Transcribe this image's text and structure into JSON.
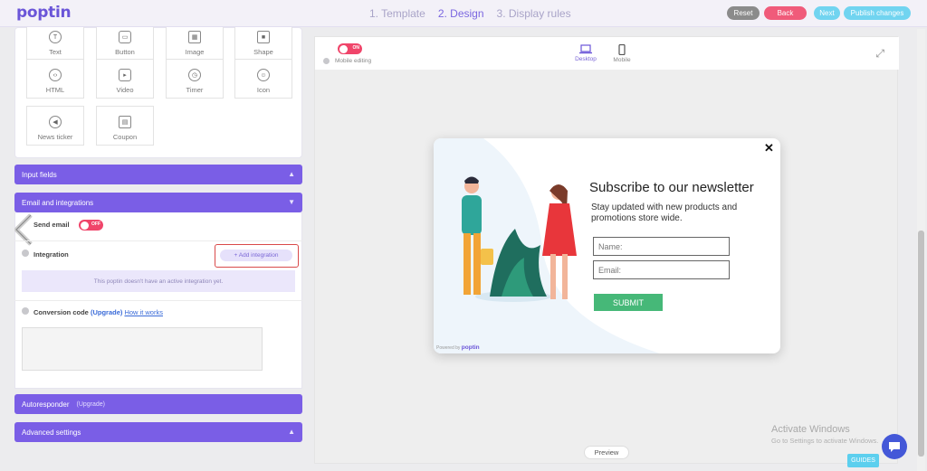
{
  "app": {
    "logo": "poptin"
  },
  "steps": [
    {
      "label": "1. Template"
    },
    {
      "label": "2. Design"
    },
    {
      "label": "3. Display rules"
    }
  ],
  "toolbar": {
    "reset": "Reset",
    "back": "Back",
    "next": "Next",
    "publish": "Publish changes"
  },
  "elements": {
    "tiles": [
      {
        "label": "Text",
        "icon": "text-icon"
      },
      {
        "label": "Button",
        "icon": "button-icon"
      },
      {
        "label": "Image",
        "icon": "image-icon"
      },
      {
        "label": "Shape",
        "icon": "shape-icon"
      },
      {
        "label": "HTML",
        "icon": "code-icon"
      },
      {
        "label": "Video",
        "icon": "video-icon"
      },
      {
        "label": "Timer",
        "icon": "timer-icon"
      },
      {
        "label": "Icon",
        "icon": "smiley-icon"
      },
      {
        "label": "News ticker",
        "icon": "megaphone-icon"
      },
      {
        "label": "Coupon",
        "icon": "coupon-icon"
      }
    ]
  },
  "panels": {
    "input_fields": "Input fields",
    "email_integrations": "Email and integrations",
    "autoresponder": "Autoresponder",
    "autoresponder_tag": "(Upgrade)",
    "advanced": "Advanced settings"
  },
  "email": {
    "send_email": "Send email",
    "toggle": "OFF",
    "integration": "Integration",
    "add_integration": "+ Add integration",
    "no_integration_note": "This poptin doesn't have an active integration yet.",
    "conversion_label": "Conversion code",
    "conversion_upgrade": "(Upgrade)",
    "how_it_works": "How it works"
  },
  "canvas": {
    "mobile_toggle": "ON",
    "mobile_editing": "Mobile editing",
    "devices": [
      {
        "label": "Desktop",
        "icon": "laptop-icon"
      },
      {
        "label": "Mobile",
        "icon": "phone-icon"
      }
    ],
    "preview": "Preview"
  },
  "popup": {
    "title": "Subscribe to our newsletter",
    "subtitle": "Stay updated with new products and promotions store  wide.",
    "name_placeholder": "Name:",
    "email_placeholder": "Email:",
    "submit": "SUBMIT",
    "powered_by": "Powered by",
    "powered_brand": "poptin"
  },
  "overlay": {
    "activate_title": "Activate Windows",
    "activate_sub": "Go to Settings to activate Windows.",
    "guides": "GUIDES"
  },
  "colors": {
    "brand": "#7a5ee6",
    "accent_red": "#f0456a",
    "submit_green": "#46b878",
    "cyan": "#71d4f0"
  }
}
